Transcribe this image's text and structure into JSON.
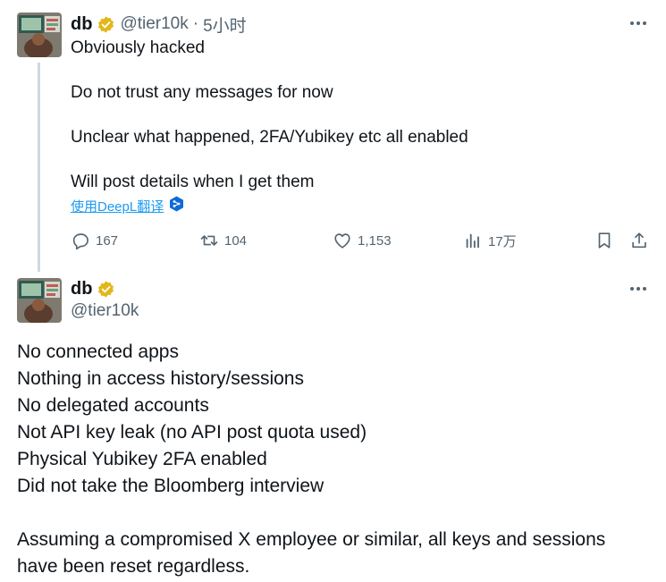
{
  "tweet1": {
    "author_name": "db",
    "handle": "@tier10k",
    "separator": "·",
    "time": "5小时",
    "lines": [
      "Obviously hacked",
      "Do not trust any messages for now",
      "Unclear what happened, 2FA/Yubikey etc all enabled",
      "Will post details when I get them"
    ],
    "translate_label": "使用DeepL翻译",
    "actions": {
      "replies": "167",
      "reposts": "104",
      "likes": "1,153",
      "views": "17万"
    }
  },
  "tweet2": {
    "author_name": "db",
    "handle": "@tier10k",
    "lines": [
      "No connected apps",
      "Nothing in access history/sessions",
      "No delegated accounts",
      "Not API key leak (no API post quota used)",
      "Physical Yubikey 2FA enabled",
      "Did not take the Bloomberg interview",
      "Assuming a compromised X employee or similar, all keys and sessions",
      "have been reset regardless."
    ]
  },
  "colors": {
    "text": "#0f1419",
    "secondary": "#536471",
    "link": "#1d9bf0",
    "verified_badge": "#e2b719",
    "thread_line": "#cfd9de"
  },
  "icons": [
    "verified-badge-icon",
    "more-icon",
    "deepl-icon",
    "reply-icon",
    "repost-icon",
    "like-icon",
    "views-icon",
    "bookmark-icon",
    "share-icon"
  ]
}
